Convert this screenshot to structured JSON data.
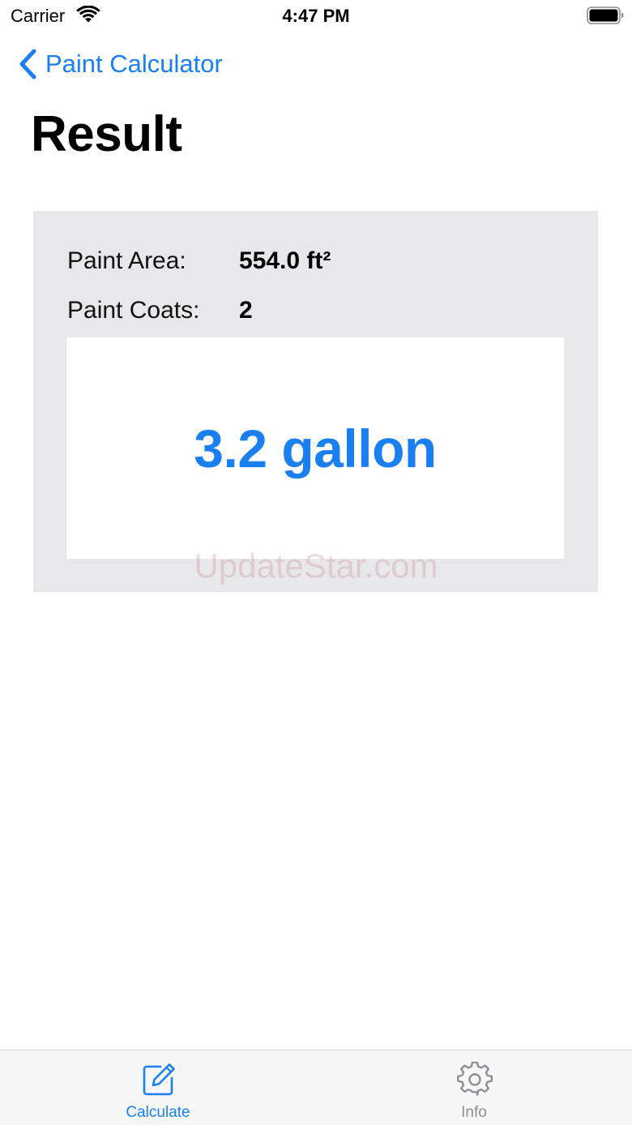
{
  "status_bar": {
    "carrier": "Carrier",
    "time": "4:47 PM",
    "wifi_icon": "wifi-icon",
    "battery_icon": "battery-icon"
  },
  "nav": {
    "back_label": "Paint Calculator",
    "back_icon": "chevron-left-icon"
  },
  "page": {
    "title": "Result"
  },
  "result": {
    "area_label": "Paint Area:",
    "area_value": "554.0 ft²",
    "coats_label": "Paint Coats:",
    "coats_value": "2",
    "gallons": "3.2 gallon"
  },
  "watermark": "UpdateStar.com",
  "tab_bar": {
    "tabs": [
      {
        "label": "Calculate",
        "icon": "pencil-square-icon",
        "selected": true
      },
      {
        "label": "Info",
        "icon": "gear-icon",
        "selected": false
      }
    ]
  },
  "colors": {
    "accent": "#1a7ff0",
    "card_background": "#e8e8ea",
    "inactive_tab": "#8e8e93"
  }
}
